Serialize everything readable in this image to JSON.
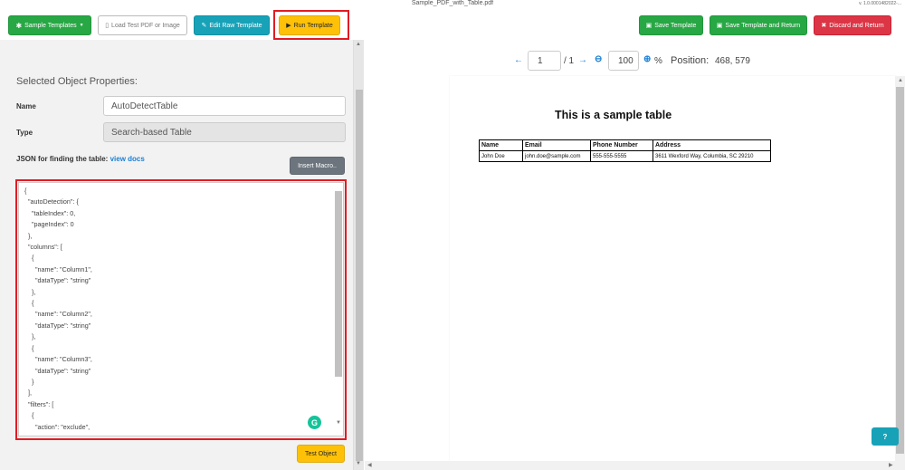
{
  "window": {
    "title": "Sample_PDF_with_Table.pdf",
    "version": "v. 1.0.0001482022-..."
  },
  "toolbar": {
    "sample_templates": "Sample Templates",
    "load_test": "Load Test PDF or Image",
    "edit_raw": "Edit Raw Template",
    "run_template": "Run Template",
    "save_template": "Save Template",
    "save_and_return": "Save Template and Return",
    "discard_and_return": "Discard and Return"
  },
  "properties": {
    "section_title": "Selected Object Properties:",
    "name_label": "Name",
    "name_value": "AutoDetectTable",
    "type_label": "Type",
    "type_value": "Search-based Table",
    "json_label": "JSON for finding the table:",
    "view_docs": "view docs",
    "insert_macro": "Insert Macro..",
    "test_object": "Test Object"
  },
  "json_text": "{\n  \"autoDetection\": {\n    \"tableIndex\": 0,\n    \"pageIndex\": 0\n  },\n  \"columns\": [\n    {\n      \"name\": \"Column1\",\n      \"dataType\": \"string\"\n    },\n    {\n      \"name\": \"Column2\",\n      \"dataType\": \"string\"\n    },\n    {\n      \"name\": \"Column3\",\n      \"dataType\": \"string\"\n    }\n  ],\n  \"filters\": [\n    {\n      \"action\": \"exclude\",",
  "viewer": {
    "page_value": "1",
    "page_total": "/ 1",
    "zoom_value": "100",
    "zoom_unit": "%",
    "position_label": "Position:",
    "position_value": "468, 579"
  },
  "pdf": {
    "title": "This is a sample table",
    "headers": [
      "Name",
      "Email",
      "Phone Number",
      "Address"
    ],
    "rows": [
      [
        "John Doe",
        "john.doe@sample.com",
        "555-555-5555",
        "3611 Wexford Way, Columbia, SC 29210"
      ]
    ]
  },
  "help": "?"
}
